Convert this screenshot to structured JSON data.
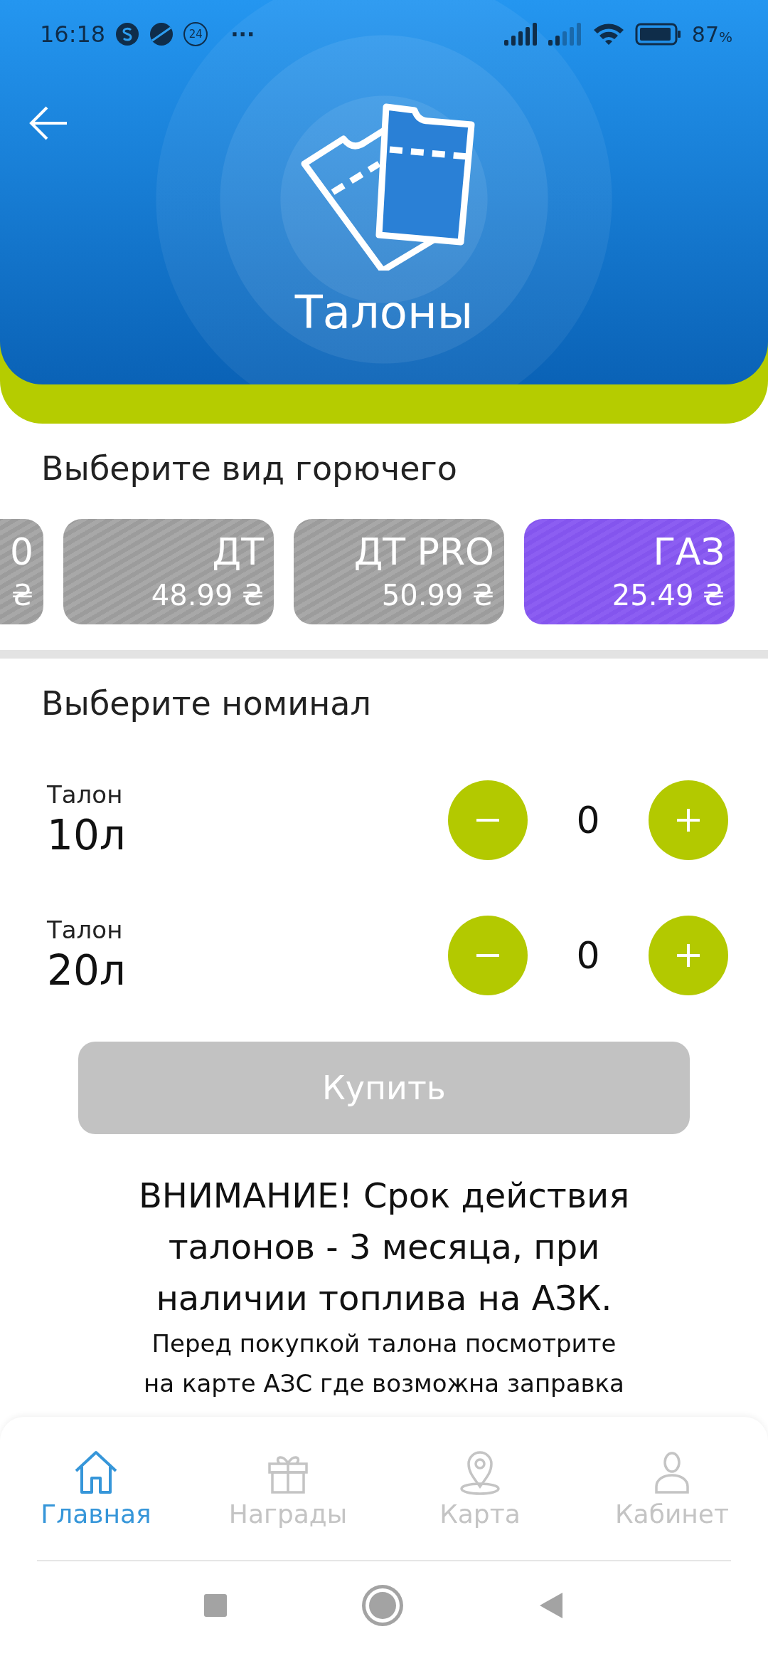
{
  "status_bar": {
    "time": "16:18",
    "badge": "24",
    "more": "···",
    "battery": "87",
    "battery_unit": "%"
  },
  "header": {
    "title": "Талоны"
  },
  "fuel": {
    "heading": "Выберите вид горючего",
    "items": [
      {
        "name": "0",
        "price": "₴",
        "selected": false
      },
      {
        "name": "ДТ",
        "price": "48.99 ₴",
        "selected": false
      },
      {
        "name": "ДТ PRO",
        "price": "50.99 ₴",
        "selected": false
      },
      {
        "name": "ГАЗ",
        "price": "25.49 ₴",
        "selected": true
      }
    ]
  },
  "nominal": {
    "heading": "Выберите номинал",
    "items": [
      {
        "label": "Талон",
        "volume": "10л",
        "count": "0"
      },
      {
        "label": "Талон",
        "volume": "20л",
        "count": "0"
      }
    ]
  },
  "buy_button": {
    "label": "Купить",
    "disabled": true
  },
  "warning": "ВНИМАНИЕ! Срок действия талонов - 3 месяца, при наличии топлива на АЗК.",
  "note": "Перед покупкой талона посмотрите на карте АЗС где возможна заправка",
  "bottom_nav": [
    {
      "kind": "home",
      "label": "Главная",
      "selected": true
    },
    {
      "kind": "gift",
      "label": "Награды",
      "selected": false
    },
    {
      "kind": "map",
      "label": "Карта",
      "selected": false
    },
    {
      "kind": "user",
      "label": "Кабинет",
      "selected": false
    }
  ]
}
